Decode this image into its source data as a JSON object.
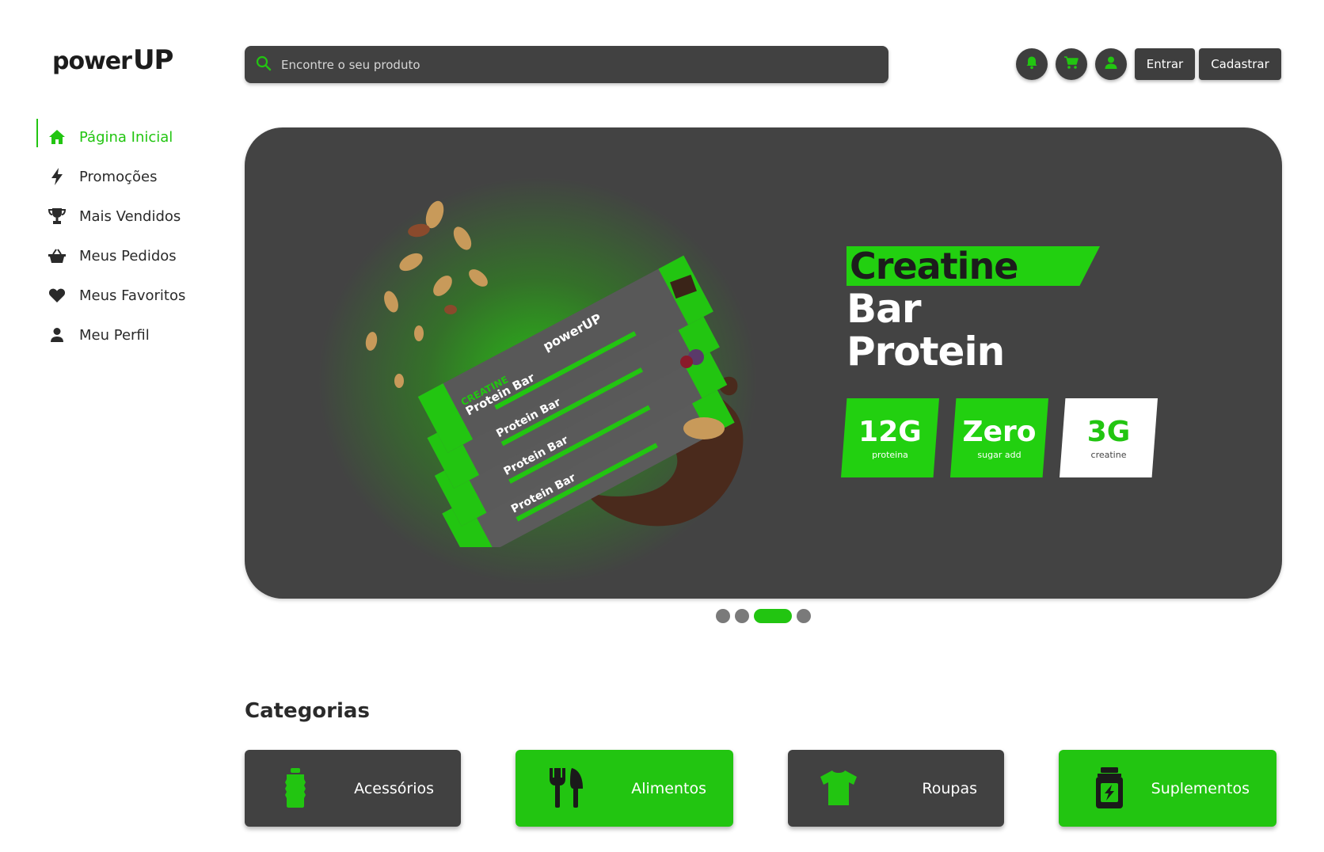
{
  "brand": {
    "logo_part1": "power",
    "logo_part2": "UP",
    "accent": "#22c511",
    "dark": "#414141"
  },
  "search": {
    "placeholder": "Encontre o seu produto"
  },
  "header": {
    "login_label": "Entrar",
    "signup_label": "Cadastrar",
    "icons": [
      "bell-icon",
      "cart-icon",
      "user-icon"
    ]
  },
  "sidebar": {
    "items": [
      {
        "label": "Página Inicial",
        "icon": "home-icon",
        "active": true
      },
      {
        "label": "Promoções",
        "icon": "lightning-icon",
        "active": false
      },
      {
        "label": "Mais Vendidos",
        "icon": "trophy-icon",
        "active": false
      },
      {
        "label": "Meus Pedidos",
        "icon": "basket-icon",
        "active": false
      },
      {
        "label": "Meus Favoritos",
        "icon": "heart-icon",
        "active": false
      },
      {
        "label": "Meu Perfil",
        "icon": "user-icon",
        "active": false
      }
    ]
  },
  "banner": {
    "headline_1": "Creatine",
    "headline_2": "Bar",
    "headline_3": "Protein",
    "badges": [
      {
        "value": "12G",
        "caption": "proteina"
      },
      {
        "value": "Zero",
        "caption": "sugar add"
      },
      {
        "value": "3G",
        "caption": "creatine"
      }
    ],
    "pack_brand": "powerUP",
    "pack_line": "CREATINE",
    "pack_name": "Protein Bar",
    "carousel_total": 4,
    "carousel_active": 3
  },
  "categories": {
    "title": "Categorias",
    "items": [
      {
        "label": "Acessórios",
        "icon": "bottle-icon",
        "style": "dark"
      },
      {
        "label": "Alimentos",
        "icon": "cutlery-icon",
        "style": "green"
      },
      {
        "label": "Roupas",
        "icon": "shirt-icon",
        "style": "dark"
      },
      {
        "label": "Suplementos",
        "icon": "supplement-jar-icon",
        "style": "green"
      }
    ]
  }
}
